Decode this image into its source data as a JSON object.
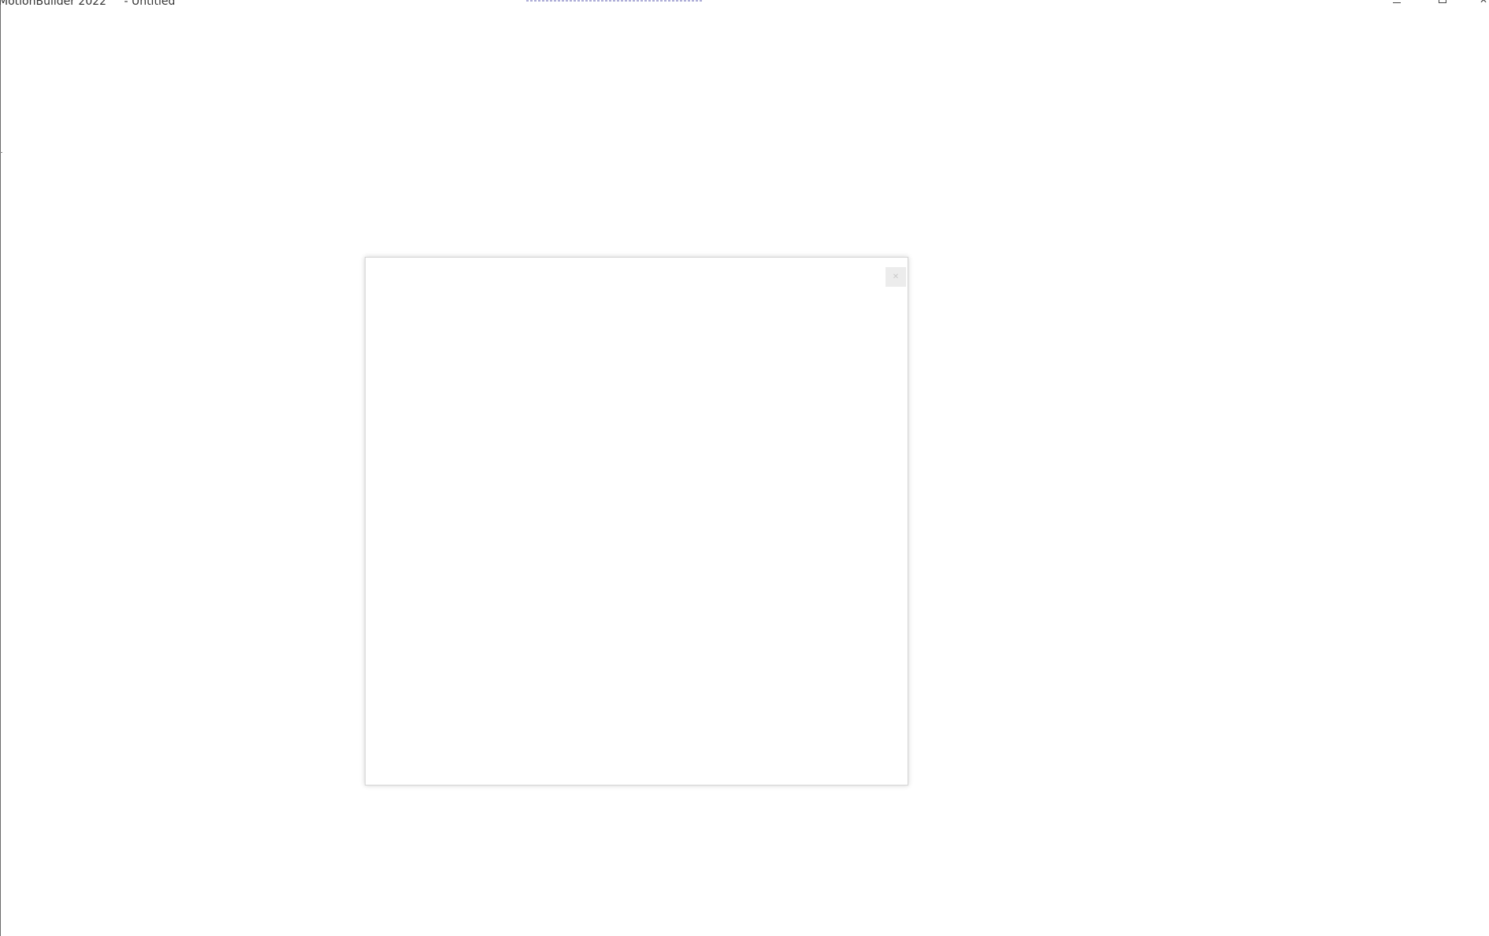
{
  "window": {
    "app_title": "MotionBuilder 2022",
    "doc_title": " - Untitled"
  },
  "window_controls": {
    "minimize_icon": "minimize-icon",
    "restore_icon": "restore-icon",
    "close_icon": "close-icon",
    "close_glyph": "✕"
  },
  "dialog": {
    "close_icon": "close-icon",
    "close_glyph": "✕"
  },
  "colors": {
    "background": "#ffffff",
    "dialog_border": "#d4d4d4",
    "close_button_bg": "#ececec"
  }
}
